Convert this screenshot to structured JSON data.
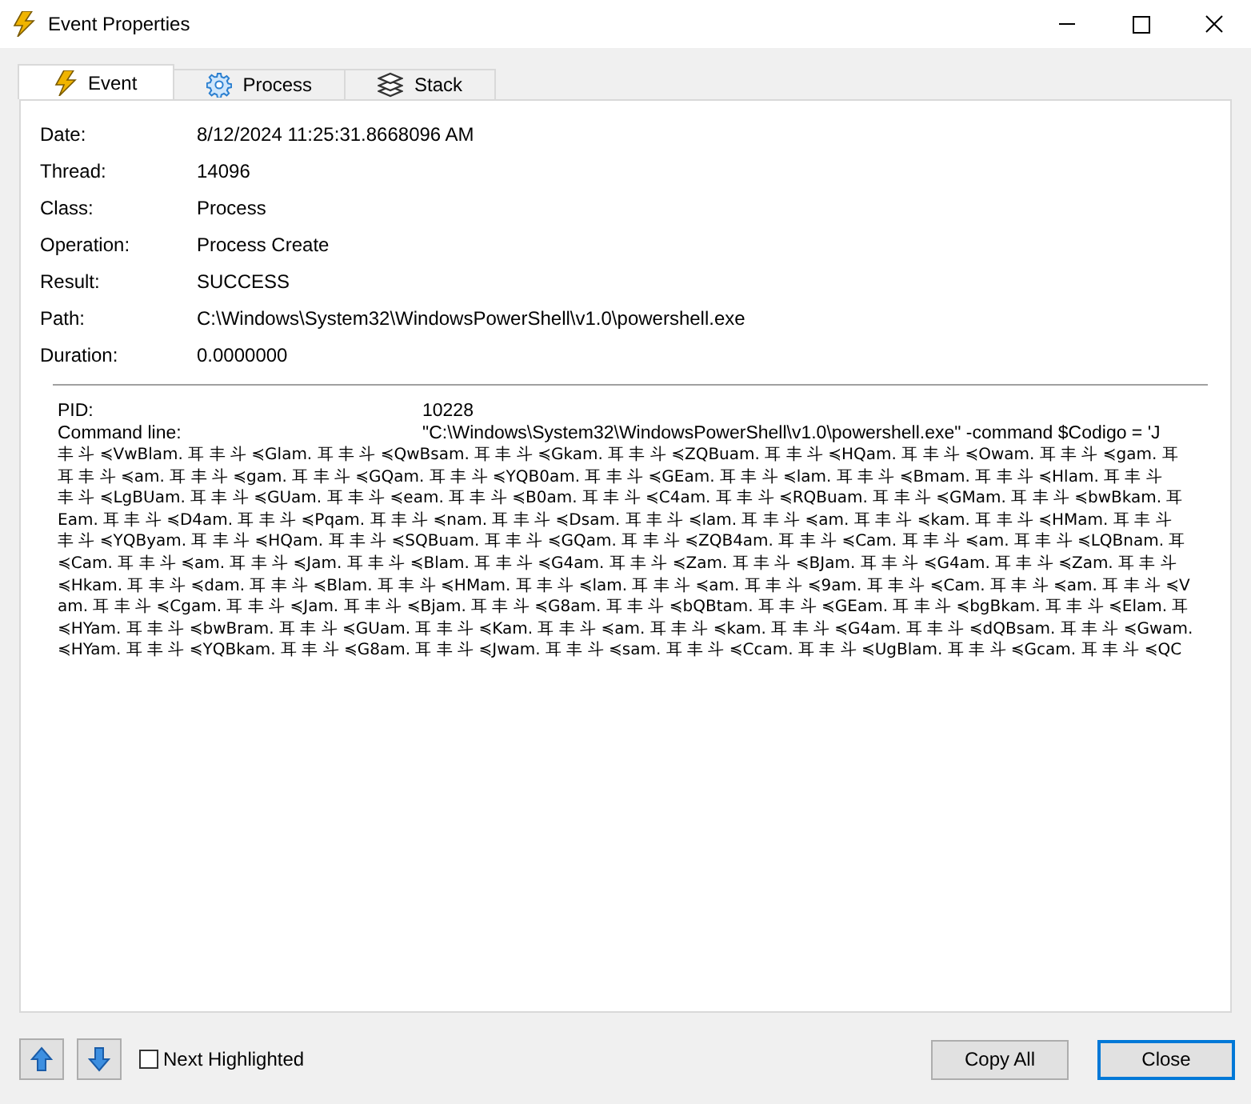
{
  "window": {
    "title": "Event Properties"
  },
  "tabs": [
    {
      "label": "Event",
      "kind": "event",
      "selected": true
    },
    {
      "label": "Process",
      "kind": "process",
      "selected": false
    },
    {
      "label": "Stack",
      "kind": "stack",
      "selected": false
    }
  ],
  "properties": [
    {
      "label": "Date:",
      "value": "8/12/2024 11:25:31.8668096 AM"
    },
    {
      "label": "Thread:",
      "value": "14096"
    },
    {
      "label": "Class:",
      "value": "Process"
    },
    {
      "label": "Operation:",
      "value": "Process Create"
    },
    {
      "label": "Result:",
      "value": "SUCCESS"
    },
    {
      "label": "Path:",
      "value": "C:\\Windows\\System32\\WindowsPowerShell\\v1.0\\powershell.exe"
    },
    {
      "label": "Duration:",
      "value": "0.0000000"
    }
  ],
  "details": {
    "fields": [
      {
        "label": "PID:",
        "value": "10228"
      },
      {
        "label": "Command line:",
        "value": "\"C:\\Windows\\System32\\WindowsPowerShell\\v1.0\\powershell.exe\" -command $Codigo = 'J"
      }
    ],
    "lines": [
      "丰 斗 ≼VwBlam. 耳 丰 斗 ≼Glam. 耳 丰 斗 ≼QwBsam. 耳 丰 斗 ≼Gkam. 耳 丰 斗 ≼ZQBuam. 耳 丰 斗 ≼HQam. 耳 丰 斗 ≼Owam. 耳 丰 斗 ≼gam. 耳",
      "耳 丰 斗 ≼am. 耳 丰 斗 ≼gam. 耳 丰 斗 ≼GQam. 耳 丰 斗 ≼YQB0am. 耳 丰 斗 ≼GEam. 耳 丰 斗 ≼lam. 耳 丰 斗 ≼Bmam. 耳 丰 斗 ≼Hlam. 耳 丰 斗",
      "丰 斗 ≼LgBUam. 耳 丰 斗 ≼GUam. 耳 丰 斗 ≼eam. 耳 丰 斗 ≼B0am. 耳 丰 斗 ≼C4am. 耳 丰 斗 ≼RQBuam. 耳 丰 斗 ≼GMam. 耳 丰 斗 ≼bwBkam. 耳",
      "Eam. 耳 丰 斗 ≼D4am. 耳 丰 斗 ≼Pqam. 耳 丰 斗 ≼nam. 耳 丰 斗 ≼Dsam. 耳 丰 斗 ≼lam. 耳 丰 斗 ≼am. 耳 丰 斗 ≼kam. 耳 丰 斗 ≼HMam. 耳 丰 斗",
      "丰 斗 ≼YQByam. 耳 丰 斗 ≼HQam. 耳 丰 斗 ≼SQBuam. 耳 丰 斗 ≼GQam. 耳 丰 斗 ≼ZQB4am. 耳 丰 斗 ≼Cam. 耳 丰 斗 ≼am. 耳 丰 斗 ≼LQBnam. 耳",
      "≼Cam. 耳 丰 斗 ≼am. 耳 丰 斗 ≼Jam. 耳 丰 斗 ≼Blam. 耳 丰 斗 ≼G4am. 耳 丰 斗 ≼Zam. 耳 丰 斗 ≼BJam. 耳 丰 斗 ≼G4am. 耳 丰 斗 ≼Zam. 耳 丰 斗",
      "≼Hkam. 耳 丰 斗 ≼dam. 耳 丰 斗 ≼Blam. 耳 丰 斗 ≼HMam. 耳 丰 斗 ≼lam. 耳 丰 斗 ≼am. 耳 丰 斗 ≼9am. 耳 丰 斗 ≼Cam. 耳 丰 斗 ≼am. 耳 丰 斗 ≼V",
      "am. 耳 丰 斗 ≼Cgam. 耳 丰 斗 ≼Jam. 耳 丰 斗 ≼Bjam. 耳 丰 斗 ≼G8am. 耳 丰 斗 ≼bQBtam. 耳 丰 斗 ≼GEam. 耳 丰 斗 ≼bgBkam. 耳 丰 斗 ≼Elam. 耳",
      "≼HYam. 耳 丰 斗 ≼bwBram. 耳 丰 斗 ≼GUam. 耳 丰 斗 ≼Kam. 耳 丰 斗 ≼am. 耳 丰 斗 ≼kam. 耳 丰 斗 ≼G4am. 耳 丰 斗 ≼dQBsam. 耳 丰 斗 ≼Gwam.",
      "≼HYam. 耳 丰 斗 ≼YQBkam. 耳 丰 斗 ≼G8am. 耳 丰 斗 ≼Jwam. 耳 丰 斗 ≼sam. 耳 丰 斗 ≼Ccam. 耳 丰 斗 ≼UgBlam. 耳 丰 斗 ≼Gcam. 耳 丰 斗 ≼QC"
    ]
  },
  "footer": {
    "next_highlighted": {
      "label": "Next Highlighted",
      "checked": false
    },
    "buttons": [
      {
        "label": "Copy All",
        "default": false
      },
      {
        "label": "Close",
        "default": true
      }
    ]
  }
}
